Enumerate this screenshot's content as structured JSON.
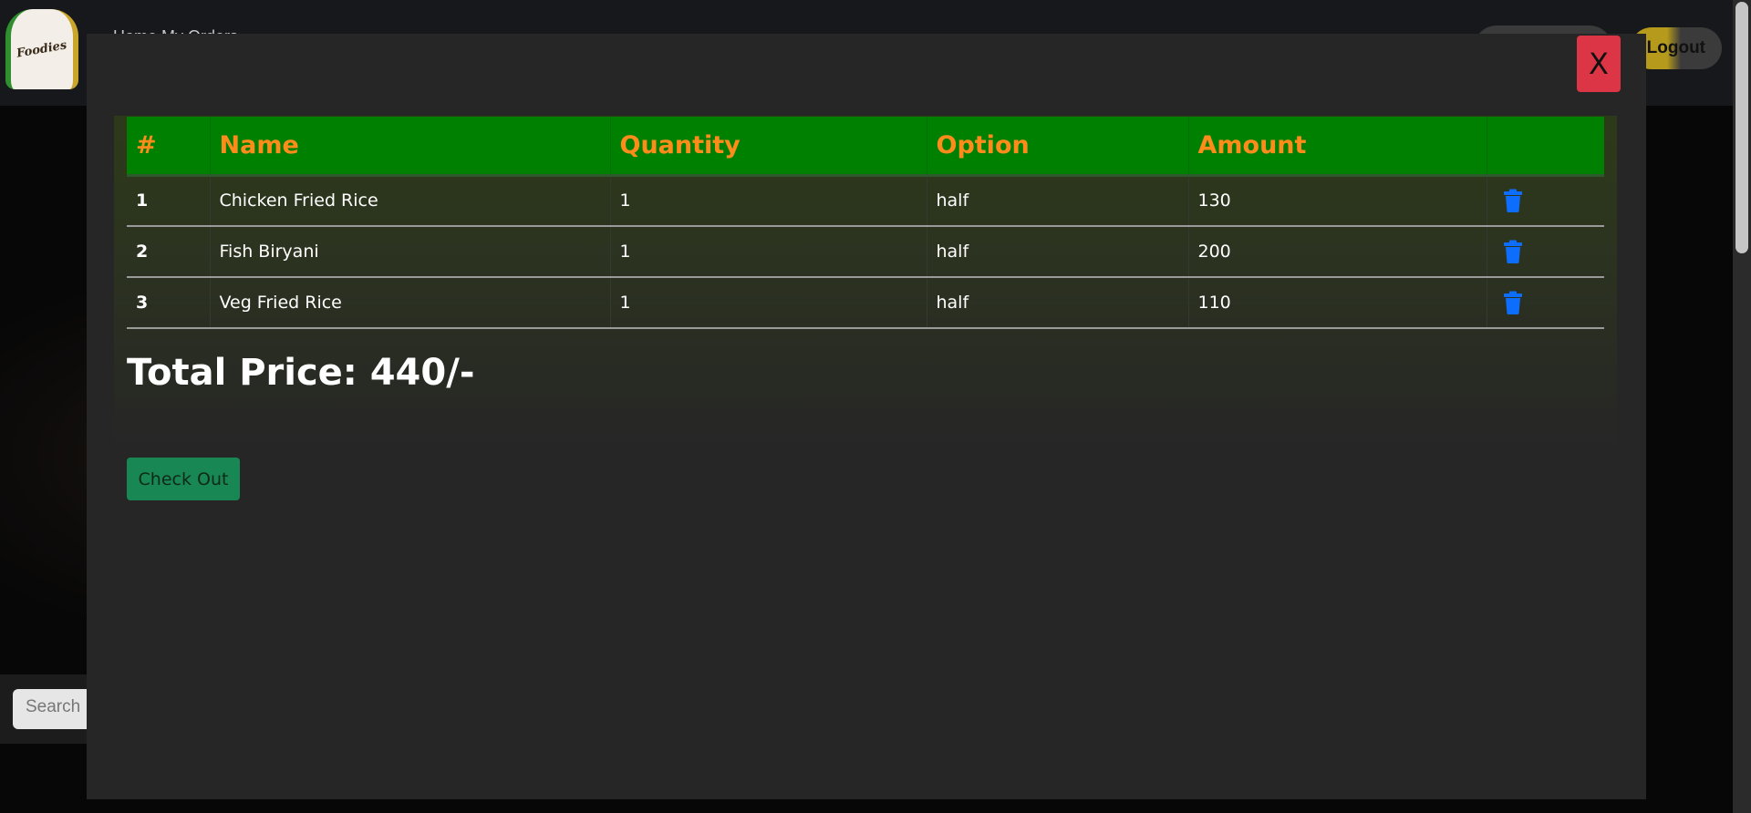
{
  "background": {
    "logo_text": "Foodies",
    "nav_link": "Home  My Orders",
    "logout_label": "Logout",
    "search_placeholder": "Search"
  },
  "modal": {
    "close_label": "X",
    "table": {
      "headers": [
        "#",
        "Name",
        "Quantity",
        "Option",
        "Amount",
        ""
      ],
      "rows": [
        {
          "index": "1",
          "name": "Chicken Fried Rice",
          "quantity": "1",
          "option": "half",
          "amount": "130"
        },
        {
          "index": "2",
          "name": "Fish Biryani",
          "quantity": "1",
          "option": "half",
          "amount": "200"
        },
        {
          "index": "3",
          "name": "Veg Fried Rice",
          "quantity": "1",
          "option": "half",
          "amount": "110"
        }
      ],
      "delete_icon": "trash-icon"
    },
    "total_text": "Total Price: 440/-",
    "checkout_label": "Check Out"
  },
  "colors": {
    "header_bg": "#008000",
    "header_text": "#ff8c1a",
    "close_button": "#dc3545",
    "checkout_button": "#198754",
    "delete_icon": "#0d6efd",
    "modal_bg": "#262626"
  }
}
